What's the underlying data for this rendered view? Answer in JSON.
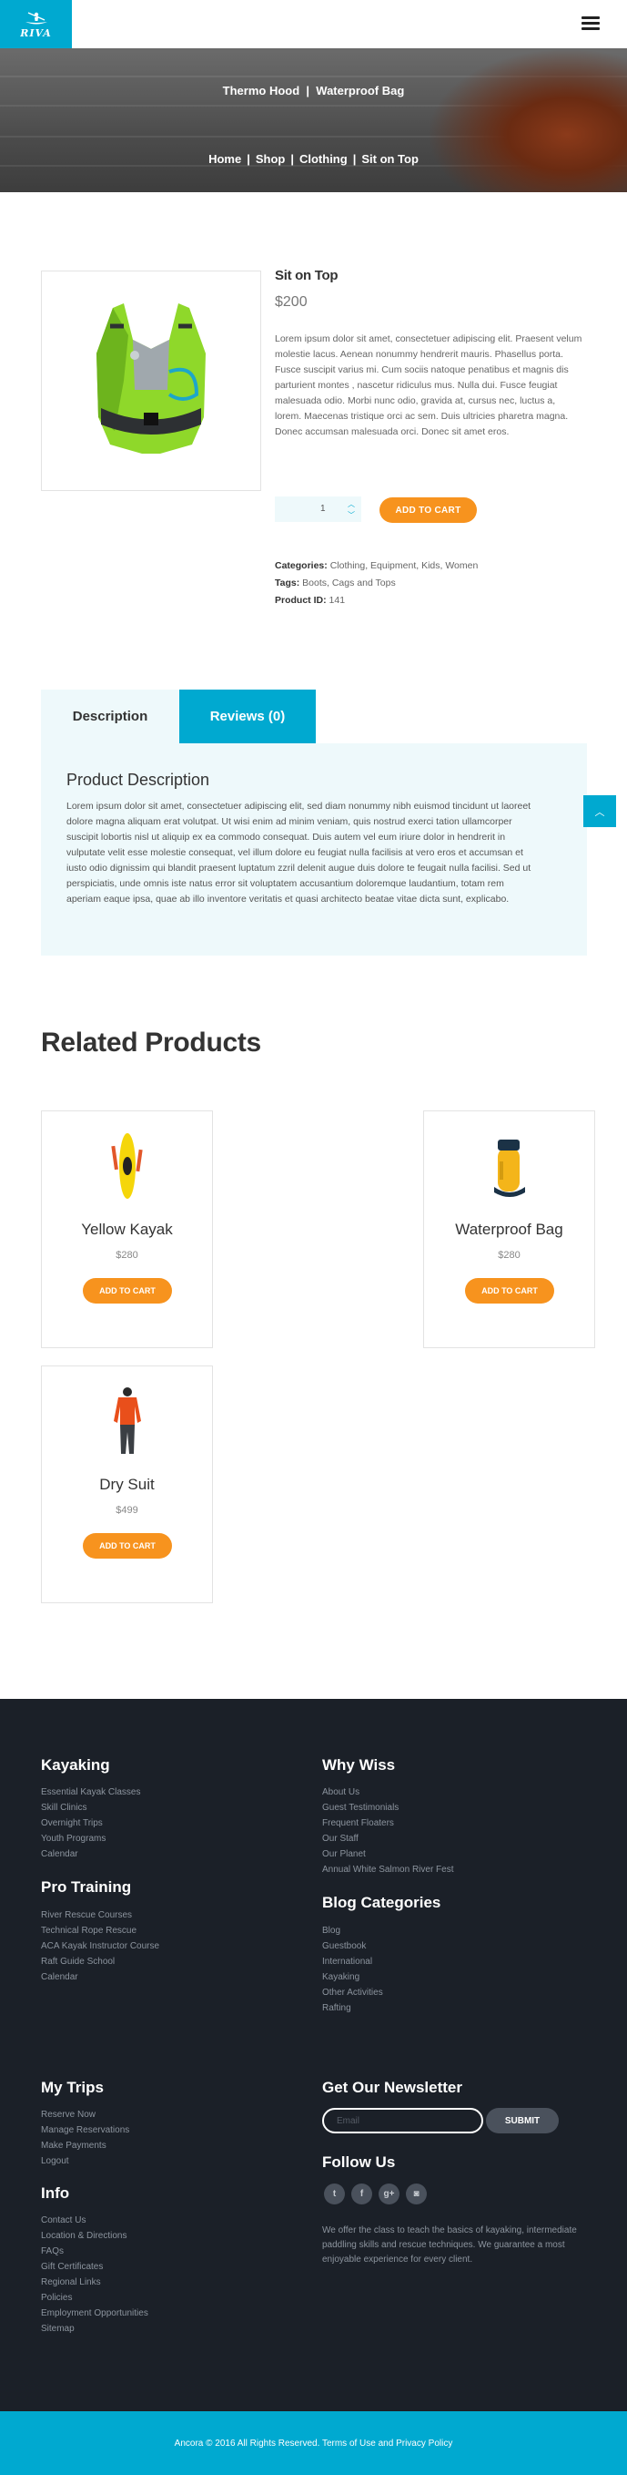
{
  "header": {
    "logo_text": "RIVA"
  },
  "hero": {
    "title_left": "Thermo Hood",
    "title_sep": "|",
    "title_right": "Waterproof Bag",
    "breadcrumb": [
      "Home",
      "Shop",
      "Clothing",
      "Sit on Top"
    ],
    "breadcrumb_sep": "|"
  },
  "product": {
    "name": "Sit on Top",
    "price": "$200",
    "description": "Lorem ipsum dolor sit amet, consectetuer adipiscing elit. Praesent velum molestie lacus. Aenean nonummy hendrerit mauris. Phasellus porta. Fusce suscipit varius mi. Cum sociis natoque penatibus et magnis dis parturient montes , nascetur ridiculus mus. Nulla dui. Fusce feugiat malesuada odio. Morbi nunc odio, gravida at, cursus nec, luctus a, lorem. Maecenas tristique orci ac sem. Duis ultricies pharetra magna. Donec accumsan malesuada orci. Donec sit amet eros.",
    "quantity": "1",
    "add_to_cart": "ADD TO CART",
    "categories_label": "Categories:",
    "categories": "Clothing, Equipment, Kids, Women",
    "tags_label": "Tags:",
    "tags": "Boots, Cags and Tops",
    "product_id_label": "Product ID:",
    "product_id": "141"
  },
  "tabs": {
    "description": "Description",
    "reviews": "Reviews (0)",
    "panel_heading": "Product Description",
    "panel_text": "Lorem ipsum dolor sit amet, consectetuer adipiscing elit, sed diam nonummy nibh euismod tincidunt ut laoreet dolore magna aliquam erat volutpat. Ut wisi enim ad minim veniam, quis nostrud exerci tation ullamcorper suscipit lobortis nisl ut aliquip ex ea commodo consequat. Duis autem vel eum iriure dolor in hendrerit in vulputate velit esse molestie consequat, vel illum dolore eu feugiat nulla facilisis at vero eros et accumsan et iusto odio dignissim qui blandit praesent luptatum zzril delenit augue duis dolore te feugait nulla facilisi. Sed ut perspiciatis, unde omnis iste natus error sit voluptatem accusantium doloremque laudantium, totam rem aperiam eaque ipsa, quae ab illo inventore veritatis et quasi architecto beatae vitae dicta sunt, explicabo."
  },
  "related": {
    "heading": "Related Products",
    "items": [
      {
        "name": "Yellow Kayak",
        "price": "$280",
        "button": "ADD TO CART",
        "icon": "kayak-icon"
      },
      {
        "name": "Waterproof Bag",
        "price": "$280",
        "button": "ADD TO CART",
        "icon": "dry-bag-icon"
      },
      {
        "name": "Dry Suit",
        "price": "$499",
        "button": "ADD TO CART",
        "icon": "dry-suit-icon"
      }
    ]
  },
  "footer": {
    "kayaking": {
      "heading": "Kayaking",
      "links": [
        "Essential Kayak Classes",
        "Skill Clinics",
        "Overnight Trips",
        "Youth Programs",
        "Calendar"
      ]
    },
    "why_wiss": {
      "heading": "Why Wiss",
      "links": [
        "About Us",
        "Guest Testimonials",
        "Frequent Floaters",
        "Our Staff",
        "Our Planet",
        "Annual White Salmon River Fest"
      ]
    },
    "pro_training": {
      "heading": "Pro Training",
      "links": [
        "River Rescue Courses",
        "Technical Rope Rescue",
        "ACA Kayak Instructor Course",
        "Raft Guide School",
        "Calendar"
      ]
    },
    "blog_categories": {
      "heading": "Blog Categories",
      "links": [
        "Blog",
        "Guestbook",
        "International",
        "Kayaking",
        "Other Activities",
        "Rafting"
      ]
    },
    "my_trips": {
      "heading": "My Trips",
      "links": [
        "Reserve Now",
        "Manage Reservations",
        "Make Payments",
        "Logout"
      ]
    },
    "info": {
      "heading": "Info",
      "links": [
        "Contact Us",
        "Location & Directions",
        "FAQs",
        "Gift Certificates",
        "Regional Links",
        "Policies",
        "Employment Opportunities",
        "Sitemap"
      ]
    },
    "newsletter": {
      "heading": "Get Our Newsletter",
      "placeholder": "Email",
      "submit": "SUBMIT"
    },
    "follow": {
      "heading": "Follow Us",
      "icons": [
        "twitter-icon",
        "facebook-icon",
        "google-plus-icon",
        "instagram-icon"
      ],
      "glyphs": [
        "t",
        "f",
        "g+",
        "◙"
      ]
    },
    "blurb": "We offer the class to teach the basics of kayaking, intermediate paddling skills and rescue techniques. We guarantee a most enjoyable experience for every client."
  },
  "bottom_bar": {
    "copyright": "Ancora © 2016 All Rights Reserved. Terms of Use and Privacy Policy"
  },
  "colors": {
    "accent": "#00a9d0",
    "button": "#f7931e",
    "footer_bg": "#1b2028",
    "panel_bg": "#eef9fb"
  }
}
